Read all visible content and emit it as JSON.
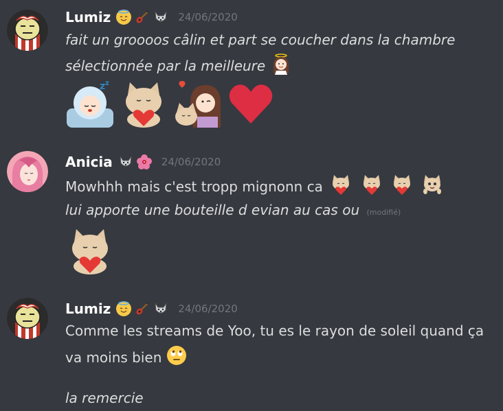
{
  "messages": [
    {
      "username": "Lumiz",
      "badges": [
        "innocent-icon",
        "guitar-icon",
        "wolf-icon"
      ],
      "timestamp": "24/06/2020",
      "line1": "fait un groooos câlin et part se coucher dans la chambre",
      "line2": "sélectionnée par la meilleure",
      "stickers": [
        "sleeping-baby-emote",
        "cat-heart-emote",
        "girl-cat-hug-emote",
        "red-heart-icon"
      ]
    },
    {
      "username": "Anicia",
      "badges": [
        "wolf-icon",
        "hibiscus-icon"
      ],
      "timestamp": "24/06/2020",
      "line1": "Mowhhh mais c'est tropp mignonn ca",
      "line2": "lui apporte une bouteille d evian au cas ou",
      "edited": "(modifié)",
      "stickers": [
        "cat-heart-emote"
      ]
    },
    {
      "username": "Lumiz",
      "badges": [
        "innocent-icon",
        "guitar-icon",
        "wolf-icon"
      ],
      "timestamp": "24/06/2020",
      "line1": "Comme les streams de Yoo, tu es le rayon de soleil quand ça",
      "line2": "va moins bien",
      "line3": "la remercie"
    }
  ],
  "colors": {
    "background": "#36393f",
    "text": "#dcddde",
    "username": "#ffffff",
    "timestamp": "#72767d"
  }
}
